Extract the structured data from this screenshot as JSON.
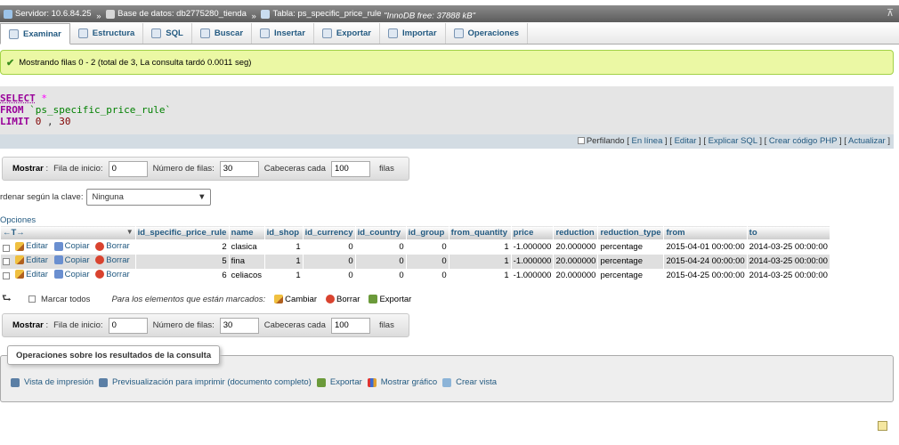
{
  "breadcrumb": {
    "server": "Servidor: 10.6.84.25",
    "database": "Base de datos: db2775280_tienda",
    "table": "Tabla: ps_specific_price_rule",
    "engine": "\"InnoDB free: 37888 kB\"",
    "separator": "»"
  },
  "tabs": [
    {
      "label": "Examinar"
    },
    {
      "label": "Estructura"
    },
    {
      "label": "SQL"
    },
    {
      "label": "Buscar"
    },
    {
      "label": "Insertar"
    },
    {
      "label": "Exportar"
    },
    {
      "label": "Importar"
    },
    {
      "label": "Operaciones"
    }
  ],
  "notice": "Mostrando filas 0 - 2 (total de 3, La consulta tardó 0.0011 seg)",
  "sql": {
    "select": "SELECT",
    "star": "*",
    "from": "FROM",
    "table": "`ps_specific_price_rule`",
    "limit": "LIMIT",
    "offset": "0",
    "comma": ",",
    "count": "30"
  },
  "sql_links": {
    "profiling": "Perfilando",
    "inline": "En línea",
    "edit": "Editar",
    "explain": "Explicar SQL",
    "php": "Crear código PHP",
    "refresh": "Actualizar"
  },
  "nav": {
    "show": "Mostrar",
    "colon": ":",
    "start_label": "Fila de inicio:",
    "start_value": "0",
    "rows_label": "Número de filas:",
    "rows_value": "30",
    "headers_label": "Cabeceras cada",
    "headers_value": "100",
    "rows_suffix": "filas"
  },
  "sort": {
    "label": "rdenar según la clave:",
    "value": "Ninguna"
  },
  "options_label": "Opciones",
  "table": {
    "columns": [
      "id_specific_price_rule",
      "name",
      "id_shop",
      "id_currency",
      "id_country",
      "id_group",
      "from_quantity",
      "price",
      "reduction",
      "reduction_type",
      "from",
      "to"
    ],
    "actions": {
      "edit": "Editar",
      "copy": "Copiar",
      "delete": "Borrar"
    },
    "rows": [
      [
        "2",
        "clasica",
        "1",
        "0",
        "0",
        "0",
        "1",
        "-1.000000",
        "20.000000",
        "percentage",
        "2015-04-01 00:00:00",
        "2014-03-25 00:00:00"
      ],
      [
        "5",
        "fina",
        "1",
        "0",
        "0",
        "0",
        "1",
        "-1.000000",
        "20.000000",
        "percentage",
        "2015-04-24 00:00:00",
        "2014-03-25 00:00:00"
      ],
      [
        "6",
        "celiacos",
        "1",
        "0",
        "0",
        "0",
        "1",
        "-1.000000",
        "20.000000",
        "percentage",
        "2015-04-25 00:00:00",
        "2014-03-25 00:00:00"
      ]
    ]
  },
  "bulk": {
    "check_all": "Marcar todos",
    "with_selected": "Para los elementos que están marcados:",
    "change": "Cambiar",
    "delete": "Borrar",
    "export": "Exportar"
  },
  "results_ops": {
    "legend": "Operaciones sobre los resultados de la consulta",
    "print_view": "Vista de impresión",
    "print_preview": "Previsualización para imprimir (documento completo)",
    "export": "Exportar",
    "chart": "Mostrar gráfico",
    "create_view": "Crear vista"
  },
  "colors": {
    "link": "#235a81",
    "notice_bg": "#ebf8a4",
    "sql_keyword": "#990099"
  }
}
